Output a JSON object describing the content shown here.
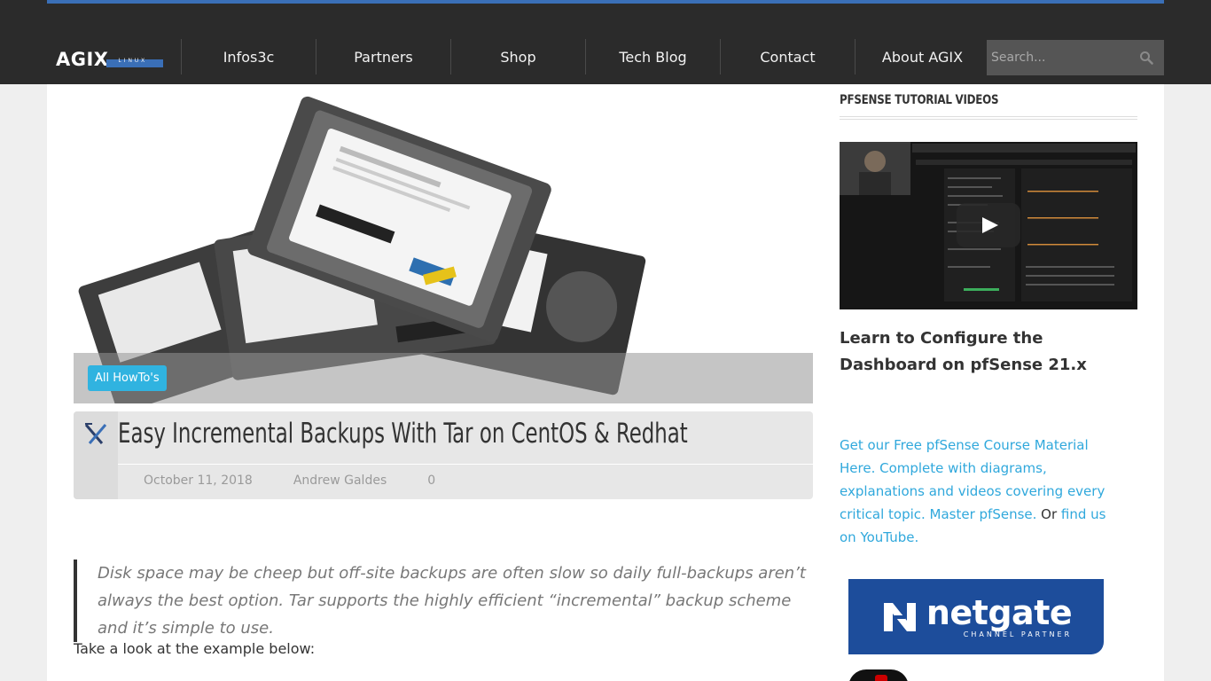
{
  "nav": {
    "logo": "AGIX",
    "logo_sub": "LINUX",
    "items": [
      "Infos3c",
      "Partners",
      "Shop",
      "Tech Blog",
      "Contact",
      "About AGIX"
    ],
    "search_placeholder": "Search..."
  },
  "article": {
    "category": "All HowTo's",
    "title": "Easy Incremental Backups With Tar on CentOS & Redhat",
    "date": "October 11, 2018",
    "author": "Andrew Galdes",
    "comments": "0",
    "quote": "Disk space may be cheep but off-site backups are often slow so daily full-backups aren’t always the best option. Tar supports the highly efficient “incremental” backup scheme and it’s simple to use.",
    "intro": "Take a look at the example below:"
  },
  "sidebar": {
    "heading": "pfSense Tutorial Videos",
    "video_title": "Learn to Configure the Dashboard on pfSense 21.x",
    "course_link": "Get our Free pfSense Course Material Here. Complete with diagrams, explanations and videos covering every critical topic. Master pfSense.",
    "connector": " Or ",
    "youtube_link": "find us on YouTube.",
    "partner_name": "netgate",
    "partner_sub": "CHANNEL PARTNER"
  },
  "colors": {
    "accent_blue": "#3a6fb7",
    "badge_cyan": "#30b3e0",
    "link_color": "#30a8dc",
    "netgate_blue": "#1d4d9b"
  }
}
